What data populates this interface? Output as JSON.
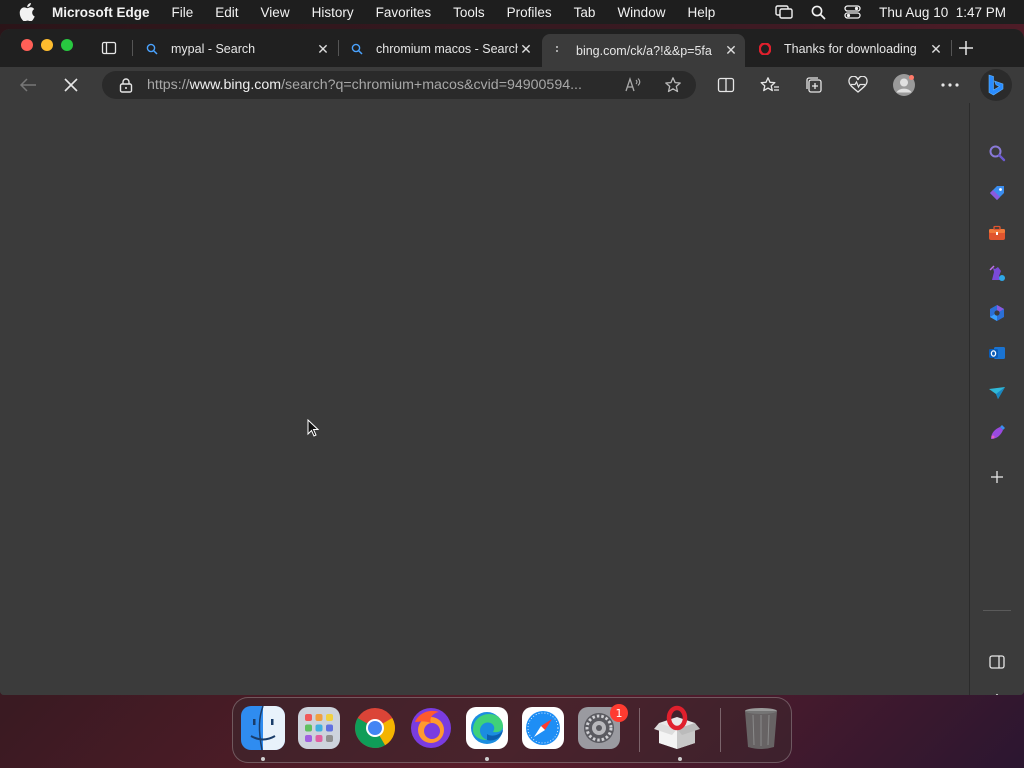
{
  "menubar": {
    "app_name": "Microsoft Edge",
    "items": [
      "File",
      "Edit",
      "View",
      "History",
      "Favorites",
      "Tools",
      "Profiles",
      "Tab",
      "Window",
      "Help"
    ],
    "datetime": "Thu Aug 10  1:47 PM"
  },
  "tabs": [
    {
      "title": "mypal - Search",
      "favicon": "bing-search-icon"
    },
    {
      "title": "chromium macos - Search",
      "favicon": "bing-search-icon"
    },
    {
      "title": "bing.com/ck/a?!&&p=5fa",
      "favicon": "loading-icon",
      "active": true
    },
    {
      "title": "Thanks for downloading",
      "favicon": "opera-icon"
    }
  ],
  "address_bar": {
    "url_prefix": "https://",
    "url_host": "www.bing.com",
    "url_rest": "/search?q=chromium+macos&cvid=94900594..."
  },
  "dock": {
    "apps": [
      "Finder",
      "Launchpad",
      "Google Chrome",
      "Firefox",
      "Microsoft Edge",
      "Safari",
      "System Settings",
      "Opera Installer",
      "Trash"
    ],
    "settings_badge": "1"
  },
  "colors": {
    "accent_bing": "#1e90ff",
    "badge_red": "#ff3b30"
  }
}
